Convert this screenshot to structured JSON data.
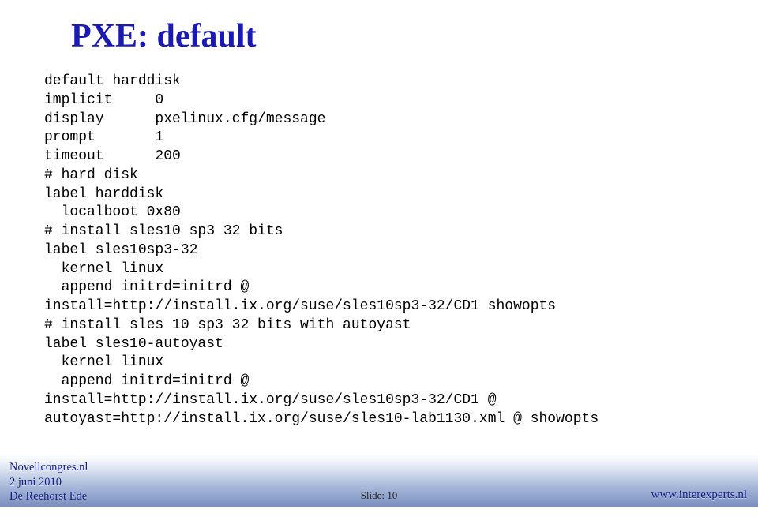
{
  "title": "PXE: default",
  "code": [
    "default harddisk",
    "implicit     0",
    "display      pxelinux.cfg/message",
    "prompt       1",
    "timeout      200",
    "# hard disk",
    "label harddisk",
    "  localboot 0x80",
    "# install sles10 sp3 32 bits",
    "label sles10sp3-32",
    "  kernel linux",
    "  append initrd=initrd @",
    "install=http://install.ix.org/suse/sles10sp3-32/CD1 showopts",
    "# install sles 10 sp3 32 bits with autoyast",
    "label sles10-autoyast",
    "  kernel linux",
    "  append initrd=initrd @",
    "install=http://install.ix.org/suse/sles10sp3-32/CD1 @",
    "autoyast=http://install.ix.org/suse/sles10-lab1130.xml @ showopts"
  ],
  "footer": {
    "left1": "Novellcongres.nl",
    "left2": "  2 juni 2010",
    "left3": "De Reehorst Ede",
    "center": "Slide: 10",
    "right": "www.interexperts.nl"
  }
}
